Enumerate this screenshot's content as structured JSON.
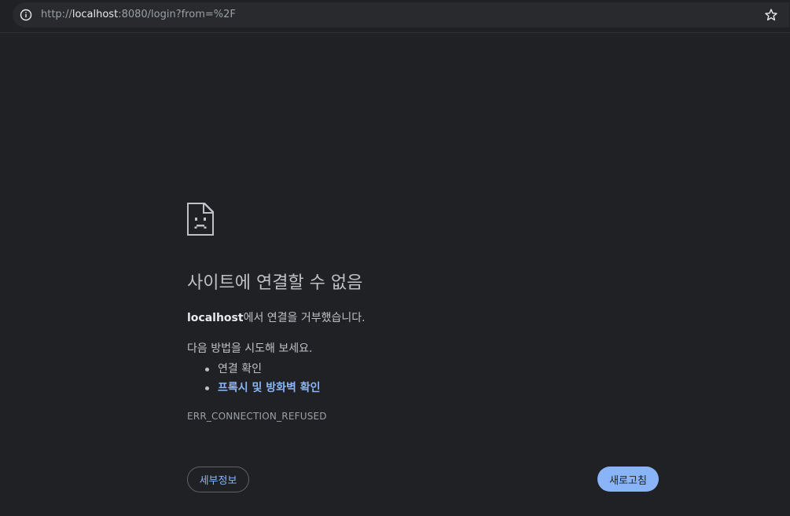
{
  "browser": {
    "url_prefix": "http://",
    "url_host": "localhost",
    "url_rest": ":8080/login?from=%2F",
    "info_icon": "info-circle-icon",
    "bookmark_icon": "star-outline-icon"
  },
  "error_page": {
    "icon": "sad-document-icon",
    "heading": "사이트에 연결할 수 없음",
    "host": "localhost",
    "refused_suffix": "에서 연결을 거부했습니다.",
    "try_label": "다음 방법을 시도해 보세요.",
    "suggestions": [
      {
        "label": "연결 확인",
        "is_link": false
      },
      {
        "label": "프록시 및 방화벽 확인",
        "is_link": true
      }
    ],
    "error_code": "ERR_CONNECTION_REFUSED",
    "details_label": "세부정보",
    "reload_label": "새로고침"
  },
  "colors": {
    "background": "#202124",
    "link": "#8ab4f8",
    "primary_button": "#8ab4f8"
  }
}
